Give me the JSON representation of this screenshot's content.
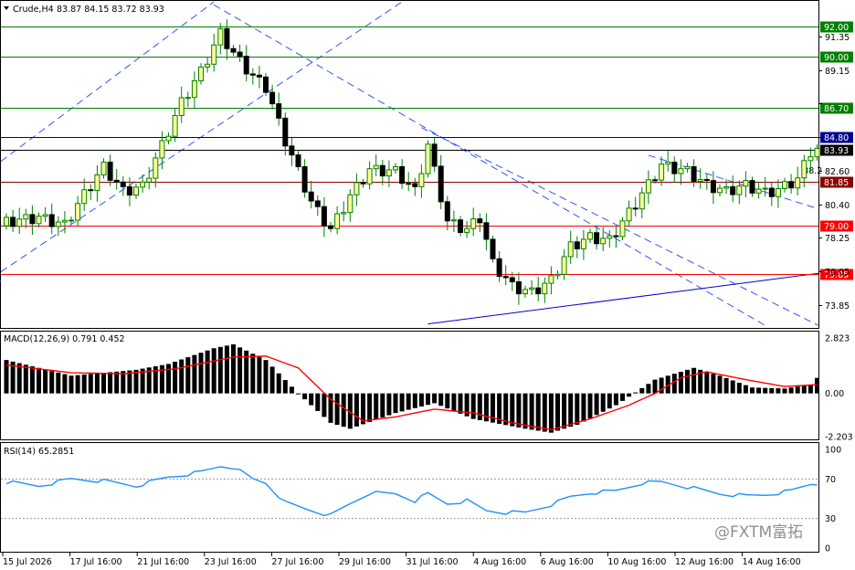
{
  "header": {
    "symbol": "Crude,H4",
    "ohlc": "83.87 84.15 83.72 83.93",
    "menu_icon": "triangle-down-icon"
  },
  "watermark": "@FXTM富拓",
  "chart_data": [
    {
      "type": "candlestick",
      "name": "price",
      "y_ticks": [
        73.85,
        76.05,
        78.25,
        80.4,
        82.6,
        84.8,
        87.0,
        89.15,
        91.35
      ],
      "y_tick_labels": [
        "73.85",
        "76.05",
        "78.25",
        "80.40",
        "82.60",
        "",
        "",
        "89.15",
        "91.35"
      ],
      "ylim": [
        72.4,
        93.6
      ],
      "x_tick_labels": [
        "15 Jul 2026",
        "17 Jul 16:00",
        "21 Jul 16:00",
        "23 Jul 16:00",
        "27 Jul 16:00",
        "29 Jul 16:00",
        "31 Jul 16:00",
        "4 Aug 16:00",
        "6 Aug 16:00",
        "10 Aug 16:00",
        "12 Aug 16:00",
        "14 Aug 16:00"
      ],
      "bar_count": 128,
      "anchors": [
        [
          0,
          79.2
        ],
        [
          5,
          79.5
        ],
        [
          9,
          79.0
        ],
        [
          12,
          81.0
        ],
        [
          15,
          82.8
        ],
        [
          18,
          81.2
        ],
        [
          21,
          81.5
        ],
        [
          24,
          84.2
        ],
        [
          27,
          87.0
        ],
        [
          30,
          89.0
        ],
        [
          33,
          91.5
        ],
        [
          35,
          90.2
        ],
        [
          38,
          88.7
        ],
        [
          40,
          88.0
        ],
        [
          43,
          84.5
        ],
        [
          47,
          80.5
        ],
        [
          50,
          78.7
        ],
        [
          53,
          80.9
        ],
        [
          56,
          82.6
        ],
        [
          60,
          82.5
        ],
        [
          63,
          81.2
        ],
        [
          65,
          84.2
        ],
        [
          68,
          79.2
        ],
        [
          71,
          78.7
        ],
        [
          73,
          79.5
        ],
        [
          75,
          76.5
        ],
        [
          78,
          75.0
        ],
        [
          81,
          74.6
        ],
        [
          84,
          75.4
        ],
        [
          87,
          77.6
        ],
        [
          90,
          78.2
        ],
        [
          93,
          78.0
        ],
        [
          97,
          80.4
        ],
        [
          101,
          82.9
        ],
        [
          105,
          82.5
        ],
        [
          108,
          81.6
        ],
        [
          111,
          81.2
        ],
        [
          114,
          81.6
        ],
        [
          117,
          81.1
        ],
        [
          119,
          81.3
        ],
        [
          122,
          82.0
        ],
        [
          124,
          83.8
        ],
        [
          125,
          83.93
        ]
      ],
      "horizontal_levels": [
        {
          "value": 92.0,
          "label": "92.00",
          "color": "#008000"
        },
        {
          "value": 90.0,
          "label": "90.00",
          "color": "#008000"
        },
        {
          "value": 86.7,
          "label": "86.70",
          "color": "#008000"
        },
        {
          "value": 84.8,
          "label": "84.80",
          "color": "#00008b"
        },
        {
          "value": 83.93,
          "label": "83.93",
          "color": "#000000"
        },
        {
          "value": 81.85,
          "label": "81.85",
          "color": "#8b0000"
        },
        {
          "value": 79.0,
          "label": "79.00",
          "color": "#ff0000"
        },
        {
          "value": 75.85,
          "label": "75.85",
          "color": "#ff0000"
        }
      ],
      "fib_label": "38.2",
      "up_color": "#ffff99",
      "down_color": "#000000",
      "wick_color": "#008000"
    },
    {
      "type": "macd",
      "title": "MACD(12,26,9) 0.791 0.452",
      "y_tick_labels": [
        "2.823",
        "0.00",
        "-2.203"
      ],
      "ylim": [
        -2.203,
        2.823
      ],
      "hist_anchors": [
        [
          0,
          1.7
        ],
        [
          10,
          0.9
        ],
        [
          20,
          1.2
        ],
        [
          25,
          1.5
        ],
        [
          32,
          2.3
        ],
        [
          35,
          2.5
        ],
        [
          40,
          1.7
        ],
        [
          45,
          0.0
        ],
        [
          50,
          -1.5
        ],
        [
          53,
          -1.8
        ],
        [
          60,
          -1.0
        ],
        [
          66,
          -0.5
        ],
        [
          72,
          -1.3
        ],
        [
          80,
          -1.8
        ],
        [
          84,
          -2.0
        ],
        [
          88,
          -1.6
        ],
        [
          94,
          -0.6
        ],
        [
          100,
          0.7
        ],
        [
          106,
          1.3
        ],
        [
          110,
          0.9
        ],
        [
          115,
          0.3
        ],
        [
          120,
          0.25
        ],
        [
          124,
          0.45
        ],
        [
          125,
          0.79
        ]
      ],
      "signal_anchors": [
        [
          0,
          1.45
        ],
        [
          10,
          1.05
        ],
        [
          18,
          1.0
        ],
        [
          26,
          1.25
        ],
        [
          35,
          1.85
        ],
        [
          40,
          1.9
        ],
        [
          45,
          1.3
        ],
        [
          50,
          -0.3
        ],
        [
          55,
          -1.4
        ],
        [
          60,
          -1.2
        ],
        [
          66,
          -0.8
        ],
        [
          72,
          -1.0
        ],
        [
          78,
          -1.5
        ],
        [
          84,
          -1.85
        ],
        [
          90,
          -1.3
        ],
        [
          96,
          -0.6
        ],
        [
          100,
          0.0
        ],
        [
          104,
          0.8
        ],
        [
          108,
          1.1
        ],
        [
          114,
          0.7
        ],
        [
          120,
          0.35
        ],
        [
          125,
          0.45
        ]
      ],
      "hist_color": "#000000",
      "signal_color": "#ff0000"
    },
    {
      "type": "line",
      "title": "RSI(14) 65.2851",
      "y_tick_labels": [
        "100",
        "70",
        "30",
        "0"
      ],
      "ylim": [
        0,
        100
      ],
      "level_lines": [
        70,
        30
      ],
      "anchors": [
        [
          0,
          67
        ],
        [
          5,
          63
        ],
        [
          10,
          70
        ],
        [
          15,
          68
        ],
        [
          20,
          63
        ],
        [
          25,
          72
        ],
        [
          30,
          77
        ],
        [
          33,
          83
        ],
        [
          35,
          82
        ],
        [
          38,
          70
        ],
        [
          40,
          66
        ],
        [
          43,
          46
        ],
        [
          46,
          40
        ],
        [
          50,
          33
        ],
        [
          53,
          45
        ],
        [
          56,
          56
        ],
        [
          60,
          55
        ],
        [
          63,
          48
        ],
        [
          65,
          55
        ],
        [
          68,
          45
        ],
        [
          71,
          48
        ],
        [
          74,
          38
        ],
        [
          77,
          36
        ],
        [
          80,
          36
        ],
        [
          84,
          44
        ],
        [
          87,
          52
        ],
        [
          90,
          56
        ],
        [
          94,
          58
        ],
        [
          98,
          66
        ],
        [
          101,
          67
        ],
        [
          105,
          62
        ],
        [
          110,
          55
        ],
        [
          114,
          53
        ],
        [
          117,
          54
        ],
        [
          121,
          58
        ],
        [
          124,
          65
        ],
        [
          125,
          65.3
        ]
      ],
      "line_color": "#1e90ff"
    }
  ]
}
